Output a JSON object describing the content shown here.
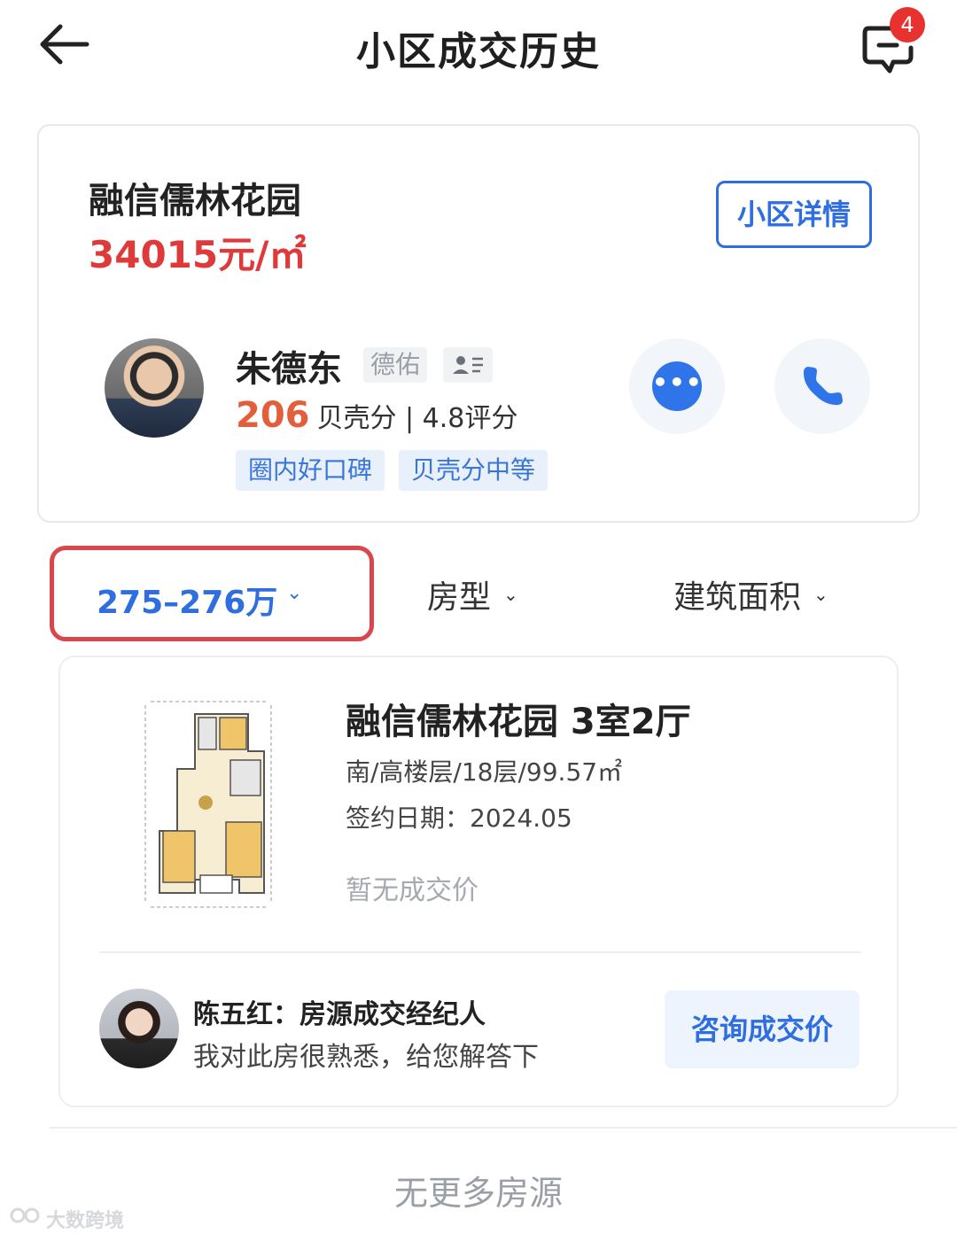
{
  "header": {
    "title": "小区成交历史",
    "message_badge": "4",
    "back_icon": "arrow-left-icon",
    "message_icon": "chat-bubble-icon"
  },
  "community": {
    "name": "融信儒林花园",
    "price": "34015元/㎡",
    "detail_button": "小区详情"
  },
  "agent": {
    "name": "朱德东",
    "company": "德佑",
    "score": "206",
    "score_label": "贝壳分 | 4.8评分",
    "tags": [
      "圈内好口碑",
      "贝壳分中等"
    ],
    "chat_dots": "•••"
  },
  "filters": {
    "price": "275–276万",
    "type": "房型",
    "area": "建筑面积"
  },
  "listing": {
    "title": "融信儒林花园 3室2厅",
    "attrs": "南/高楼层/18层/99.57㎡",
    "sign_date": "签约日期：2024.05",
    "price_status": "暂无成交价",
    "agent_name": "陈五红：房源成交经纪人",
    "agent_message": "我对此房很熟悉，给您解答下",
    "consult_button": "咨询成交价"
  },
  "footer": {
    "no_more": "无更多房源"
  },
  "watermark": "大数跨境",
  "colors": {
    "accent_blue": "#2e6ee0",
    "price_red": "#e0393a",
    "highlight_border": "#d9474d"
  }
}
